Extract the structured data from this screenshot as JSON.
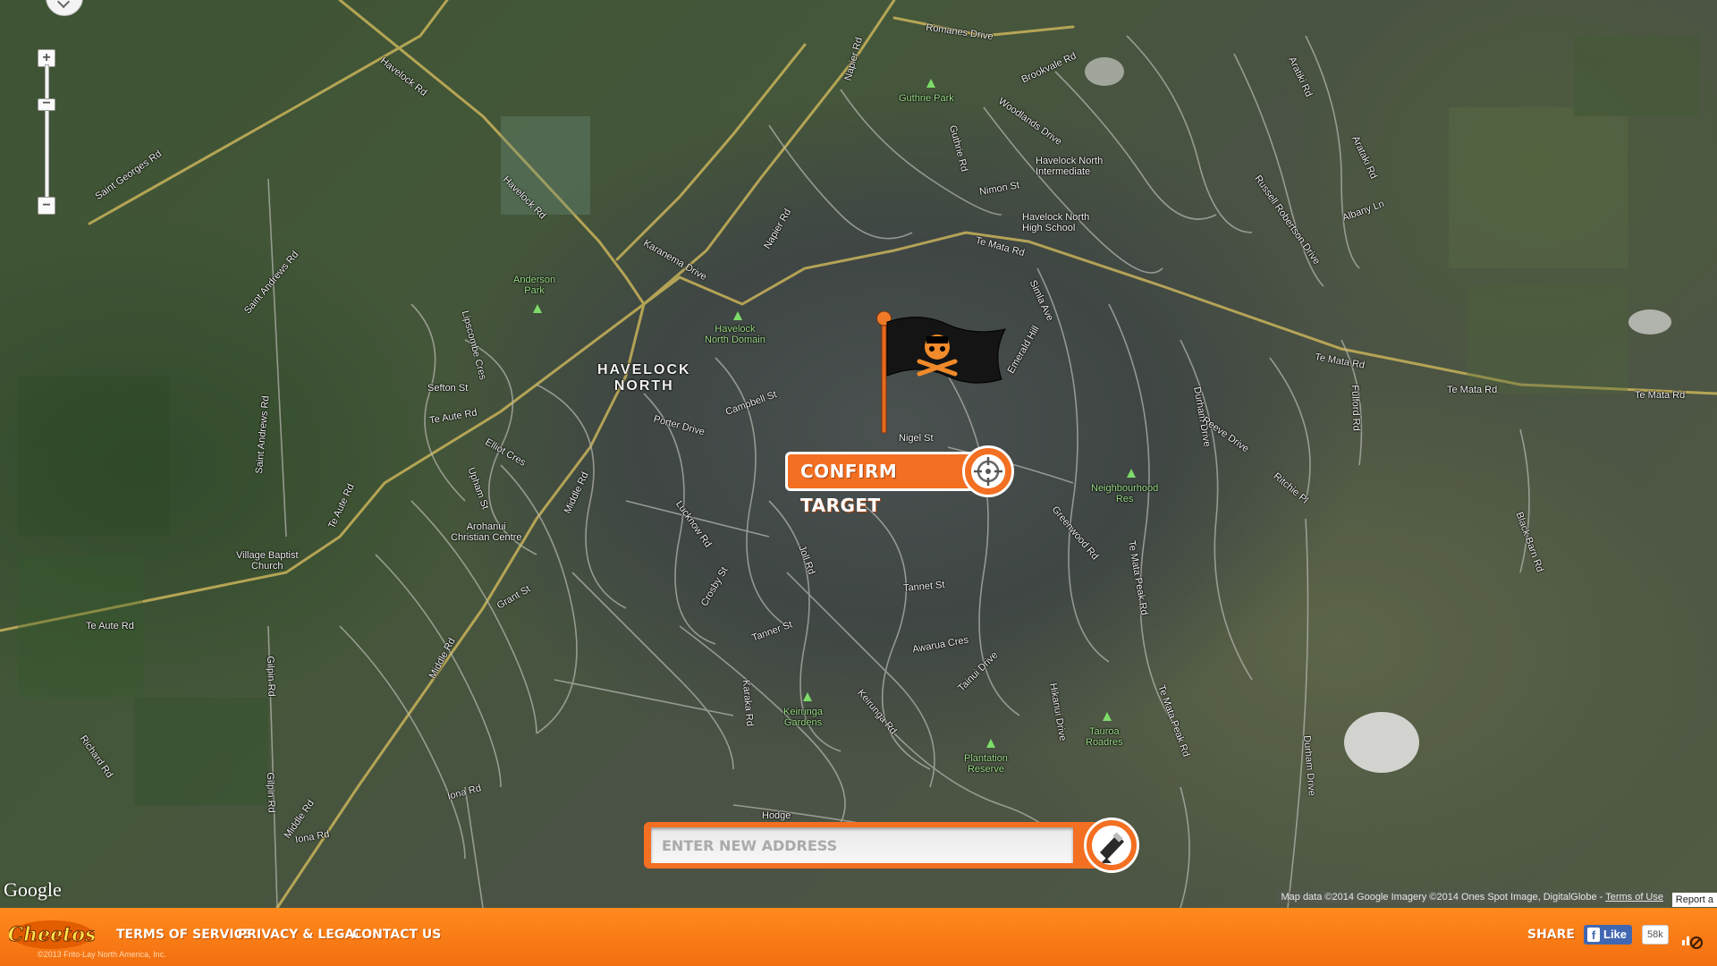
{
  "map": {
    "labels": {
      "town": "HAVELOCK\nNORTH",
      "guthrie_park": "Guthrie Park",
      "havelock_north_intermediate": "Havelock North\nIntermediate",
      "havelock_north_high_school": "Havelock North\nHigh School",
      "anderson_park": "Anderson\nPark",
      "havelock_north_domain": "Havelock\nNorth Domain",
      "arohanui": "Arohanui\nChristian Centre",
      "village_baptist": "Village Baptist\nChurch",
      "neighbourhood_res": "Neighbourhood\nRes",
      "keirunga_gardens": "Keirunga\nGardens",
      "plantation_reserve": "Plantation\nReserve",
      "tauroa_roadres": "Tauroa\nRoadres",
      "havelock_rd": "Havelock Rd",
      "havelock_rd_2": "Havelock Rd",
      "saint_georges_rd": "Saint Georges Rd",
      "saint_andrews_rd": "Saint Andrews Rd",
      "saint_andrews_rd_2": "Saint Andrews Rd",
      "te_aute_rd": "Te Aute Rd",
      "te_aute_rd_2": "Te Aute Rd",
      "te_aute_rd_3": "Te Aute Rd",
      "middle_rd": "Middle Rd",
      "middle_rd_2": "Middle Rd",
      "middle_rd_3": "Middle Rd",
      "te_mata_rd": "Te Mata Rd",
      "te_mata_rd_2": "Te Mata Rd",
      "te_mata_rd_3": "Te Mata Rd",
      "te_mata_rd_4": "Te Mata Rd",
      "napier_rd": "Napier Rd",
      "napier_rd_2": "Napier Rd",
      "romanes_drive": "Romanes Drive",
      "brookvale_rd": "Brookvale Rd",
      "karanema_drive": "Karanema Drive",
      "te_mata_peak_rd": "Te Mata Peak Rd",
      "te_mata_peak_rd_2": "Te Mata Peak Rd",
      "durham_drive": "Durham Drive",
      "durham_drive_2": "Durham Drive",
      "iona_rd": "Iona Rd",
      "iona_rd_2": "Iona Rd",
      "gilpin_rd": "Gilpin Rd",
      "gilpin_rd_2": "Gilpin Rd",
      "richard_rd": "Richard Rd",
      "tanner_st": "Tanner St",
      "tanner_st_2": "Tanner St",
      "campbell_st": "Campbell St",
      "porter_drive": "Porter Drive",
      "sefton_st": "Sefton St",
      "grant_st": "Grant St",
      "simla_ave": "Simla Ave",
      "fulford_rd": "Fulford Rd",
      "russell_robertson_drive": "Russell Robertson Drive",
      "greenwood_rd": "Greenwood Rd",
      "ritchie_pl": "Ritchie Pl",
      "reeve_drive": "Reeve Drive",
      "keirunga_rd": "Keirunga Rd",
      "crosby_st": "Crosby St",
      "lucknow_rd": "Lucknow Rd",
      "elliot_cres": "Elliot Cres",
      "woodlands_drive": "Woodlands Drive",
      "nimon_st": "Nimon St",
      "guthrie_rd": "Guthrie Rd",
      "emerald_hill": "Emerald Hill",
      "hikanui_drive": "Hikanui Drive",
      "tainui_drive": "Tainui Drive",
      "awarua_cres": "Awarua Cres",
      "karaka_rd": "Karaka Rd",
      "lipscombe_cres": "Lipscombe Cres",
      "upham_st": "Upham St",
      "nigel_st": "Nigel St",
      "joll_rd": "Joll Rd",
      "tannet_st": "Tannet St",
      "albany_ln": "Albany Ln",
      "aratiki_rd": "Aratiki Rd",
      "arataki_rd": "Arataki Rd",
      "black_barn_rd": "Black Barn Rd",
      "hodge": "Hodge"
    },
    "google_logo": "Google",
    "attribution": "Map data ©2014 Google Imagery ©2014 Ones Spot Image, DigitalGlobe -",
    "terms_of_use": "Terms of Use",
    "report_link": "Report a"
  },
  "flag": {
    "icon": "pirate-flag-icon"
  },
  "confirm_target": {
    "label": "Confirm Target",
    "icon": "crosshair-icon"
  },
  "address": {
    "placeholder": "ENTER NEW ADDRESS",
    "value": "",
    "go_icon": "catapult-icon"
  },
  "footer": {
    "logo_text": "Cheetos",
    "copyright": "©2013 Frito-Lay North America, Inc.",
    "links": {
      "terms": "Terms of Service",
      "privacy": "Privacy & Legal",
      "contact": "Contact Us"
    },
    "share": "Share",
    "fb_like": "Like",
    "fb_count": "58k",
    "audio_icon": "audio-icon"
  },
  "colors": {
    "brand_orange": "#f36f21",
    "footer_orange": "#ff8a1e",
    "facebook_blue": "#4267b2"
  }
}
